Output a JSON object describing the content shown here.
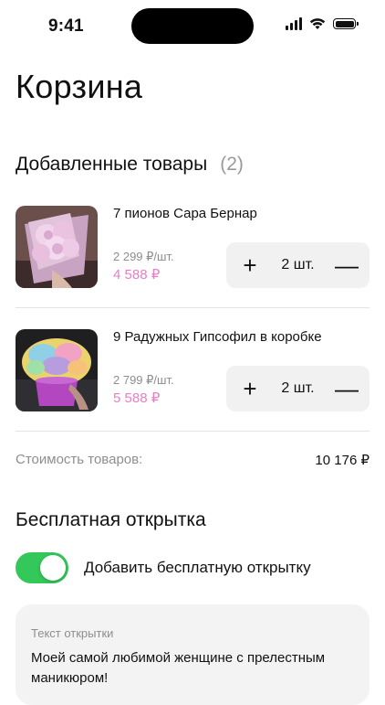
{
  "status_bar": {
    "time": "9:41"
  },
  "page": {
    "title": "Корзина"
  },
  "cart": {
    "heading": "Добавленные товары",
    "count": "(2)",
    "items": [
      {
        "name": "7 пионов Сара Бернар",
        "unit_price": "2 299 ₽/шт.",
        "total_price": "4 588 ₽",
        "quantity": "2 шт.",
        "plus": "+",
        "minus": "—"
      },
      {
        "name": "9 Радужных Гипсофил в коробке",
        "unit_price": "2 799 ₽/шт.",
        "total_price": "5 588 ₽",
        "quantity": "2 шт.",
        "plus": "+",
        "minus": "—"
      }
    ],
    "summary_label": "Стоимость товаров:",
    "summary_value": "10 176 ₽"
  },
  "postcard": {
    "heading": "Бесплатная открытка",
    "toggle_label": "Добавить бесплатную открытку",
    "toggle_on": true,
    "text_label": "Текст открытки",
    "text_value": "Моей самой любимой женщине с прелестным маникюром!"
  },
  "colors": {
    "accent_price": "#e77fc3",
    "toggle_on": "#34c759",
    "muted_text": "#8e8e8e"
  }
}
